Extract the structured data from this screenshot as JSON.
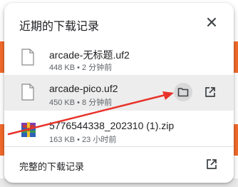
{
  "downloads": {
    "title": "近期的下载记录",
    "items": [
      {
        "name": "arcade-无标题.uf2",
        "meta": "448 KB • 2 分钟前",
        "icon": "file-icon"
      },
      {
        "name": "arcade-pico.uf2",
        "meta": "450 KB • 8 分钟前",
        "icon": "file-icon"
      },
      {
        "name": "5776544338_202310 (1).zip",
        "meta": "163 KB • 23 小时前",
        "icon": "zip-archive-icon"
      }
    ],
    "footer_label": "完整的下载记录"
  },
  "colors": {
    "accent_orange": "#f26b2c",
    "annotation_red": "#e8322a",
    "hover_row": "#ededed"
  }
}
